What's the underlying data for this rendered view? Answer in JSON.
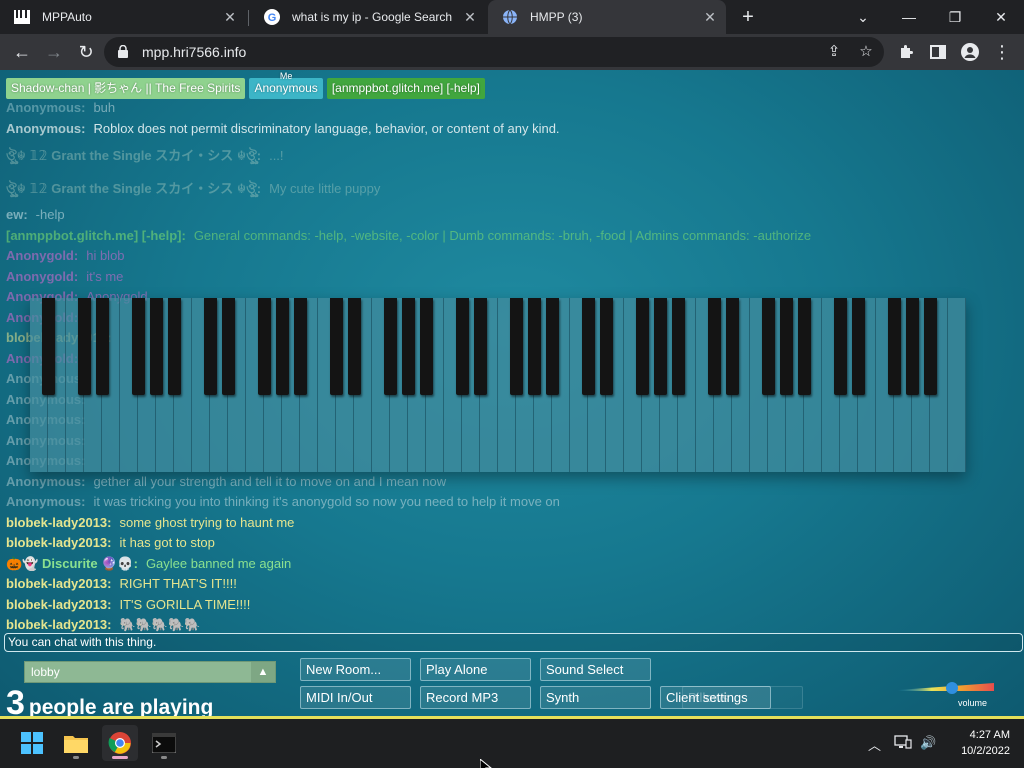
{
  "browser": {
    "tabs": [
      {
        "title": "MPPAuto",
        "icon": "piano-keys-icon"
      },
      {
        "title": "what is my ip - Google Search",
        "icon": "google-icon"
      },
      {
        "title": "HMPP (3)",
        "icon": "globe-icon",
        "active": true
      }
    ],
    "url": "mpp.hri7566.info"
  },
  "room": {
    "participants": [
      {
        "name": "Shadow-chan | 影ちゃん || The Free Spirits",
        "color": "#8fd28e"
      },
      {
        "name": "Anonymous",
        "color": "#3cb5c7",
        "me_label": "Me"
      },
      {
        "name": "[anmppbot.glitch.me] [-help]",
        "color": "#41a63e"
      }
    ],
    "chat": [
      {
        "name": "Anonymous:",
        "text": "buh",
        "name_color": "#8fbfc8",
        "text_color": "#c6dde2",
        "style": "faint2"
      },
      {
        "name": "Anonymous:",
        "text": "Roblox does not permit discriminatory language, behavior, or content of any kind.",
        "name_color": "#a9c9cf",
        "text_color": "#d4e6ea",
        "style": ""
      },
      {
        "name": "ঔৣ☬ 𝟙𝟚 Grant the Single スカイ・シス ☬ঔৣ:",
        "text": "...!",
        "name_color": "#d6e8d3",
        "text_color": "#d6e8d3",
        "style": "faint tall"
      },
      {
        "name": "ঔৣ☬ 𝟙𝟚 Grant the Single スカイ・シス ☬ঔৣ:",
        "text": "My cute little puppy",
        "name_color": "#d6e8d3",
        "text_color": "#d6e8d3",
        "style": "faint tall"
      },
      {
        "name": "ew:",
        "text": "-help",
        "name_color": "#cfe6ea",
        "text_color": "#cfe6ea",
        "style": "faint2"
      },
      {
        "name": "[anmppbot.glitch.me] [-help]:",
        "text": "General commands: -help, -website, -color | Dumb commands: -bruh, -food | Admins commands: -authorize",
        "name_color": "#7fe36f",
        "text_color": "#7fe36f",
        "style": "faint2"
      },
      {
        "name": "Anonygold:",
        "text": "hi blob",
        "name_color": "#d66ad2",
        "text_color": "#d66ad2",
        "style": "faint2"
      },
      {
        "name": "Anonygold:",
        "text": "it's me",
        "name_color": "#d66ad2",
        "text_color": "#d66ad2",
        "style": "faint2"
      },
      {
        "name": "Anonygold:",
        "text": "Anonygold",
        "name_color": "#d66ad2",
        "text_color": "#d66ad2",
        "style": "faint2"
      },
      {
        "name": "Anonygold:",
        "text": "",
        "name_color": "#d66ad2",
        "text_color": "#d66ad2",
        "style": "faint2"
      },
      {
        "name": "blobek-lady2013:",
        "text": "",
        "name_color": "#e6e58f",
        "text_color": "#e6e58f",
        "style": "faint2"
      },
      {
        "name": "Anonygold:",
        "text": "",
        "name_color": "#d66ad2",
        "text_color": "#d66ad2",
        "style": "faint2"
      },
      {
        "name": "Anonymous:",
        "text": "",
        "name_color": "#a9c9cf",
        "text_color": "#a9c9cf",
        "style": "faint2"
      },
      {
        "name": "Anonymous:",
        "text": "",
        "name_color": "#a9c9cf",
        "text_color": "#a9c9cf",
        "style": "faint2"
      },
      {
        "name": "Anonymous:",
        "text": "",
        "name_color": "#a9c9cf",
        "text_color": "#a9c9cf",
        "style": "faint2"
      },
      {
        "name": "Anonymous:",
        "text": "",
        "name_color": "#a9c9cf",
        "text_color": "#a9c9cf",
        "style": "faint2"
      },
      {
        "name": "Anonymous:",
        "text": "",
        "name_color": "#a9c9cf",
        "text_color": "#a9c9cf",
        "style": "faint2"
      },
      {
        "name": "Anonymous:",
        "text": "gether all your strength and tell it to move on and I mean now",
        "name_color": "#a9c9cf",
        "text_color": "#c6dde2",
        "style": "faint2"
      },
      {
        "name": "Anonymous:",
        "text": "it was tricking you into thinking it's anonygold so now you need to help it move on",
        "name_color": "#a9c9cf",
        "text_color": "#c6dde2",
        "style": "faint2"
      },
      {
        "name": "blobek-lady2013:",
        "text": "some ghost trying to haunt me",
        "name_color": "#e6e58f",
        "text_color": "#e6e58f",
        "style": ""
      },
      {
        "name": "blobek-lady2013:",
        "text": "it has got to stop",
        "name_color": "#e6e58f",
        "text_color": "#e6e58f",
        "style": ""
      },
      {
        "name": "🎃👻 Discurite 🔮💀:",
        "text": "Gaylee banned me again",
        "name_color": "#8be08f",
        "text_color": "#8be08f",
        "style": ""
      },
      {
        "name": "blobek-lady2013:",
        "text": "RIGHT THAT'S IT!!!!",
        "name_color": "#e6e58f",
        "text_color": "#e6e58f",
        "style": ""
      },
      {
        "name": "blobek-lady2013:",
        "text": "IT'S GORILLA TIME!!!!",
        "name_color": "#e6e58f",
        "text_color": "#e6e58f",
        "style": ""
      },
      {
        "name": "blobek-lady2013:",
        "text": "🐘🐘🐘🐘🐘",
        "name_color": "#e6e58f",
        "text_color": "#e6e58f",
        "style": ""
      }
    ],
    "chat_placeholder": "You can chat with this thing.",
    "room_name": "lobby",
    "player_count": "3",
    "player_text": "people are playing",
    "buttons": {
      "new_room": "New Room...",
      "play_alone": "Play Alone",
      "sound_select": "Sound Select",
      "midi": "MIDI In/Out",
      "record": "Record MP3",
      "synth": "Synth",
      "client_settings": "Client settings",
      "hidden_button": "Pillows"
    },
    "volume_label": "volume",
    "piano": {
      "white_keys": 52,
      "black_key_pattern": "A0 to C8"
    }
  },
  "taskbar": {
    "apps": [
      "windows-start-icon",
      "file-explorer-icon",
      "chrome-icon",
      "terminal-icon"
    ],
    "time": "4:27 AM",
    "date": "10/2/2022"
  }
}
